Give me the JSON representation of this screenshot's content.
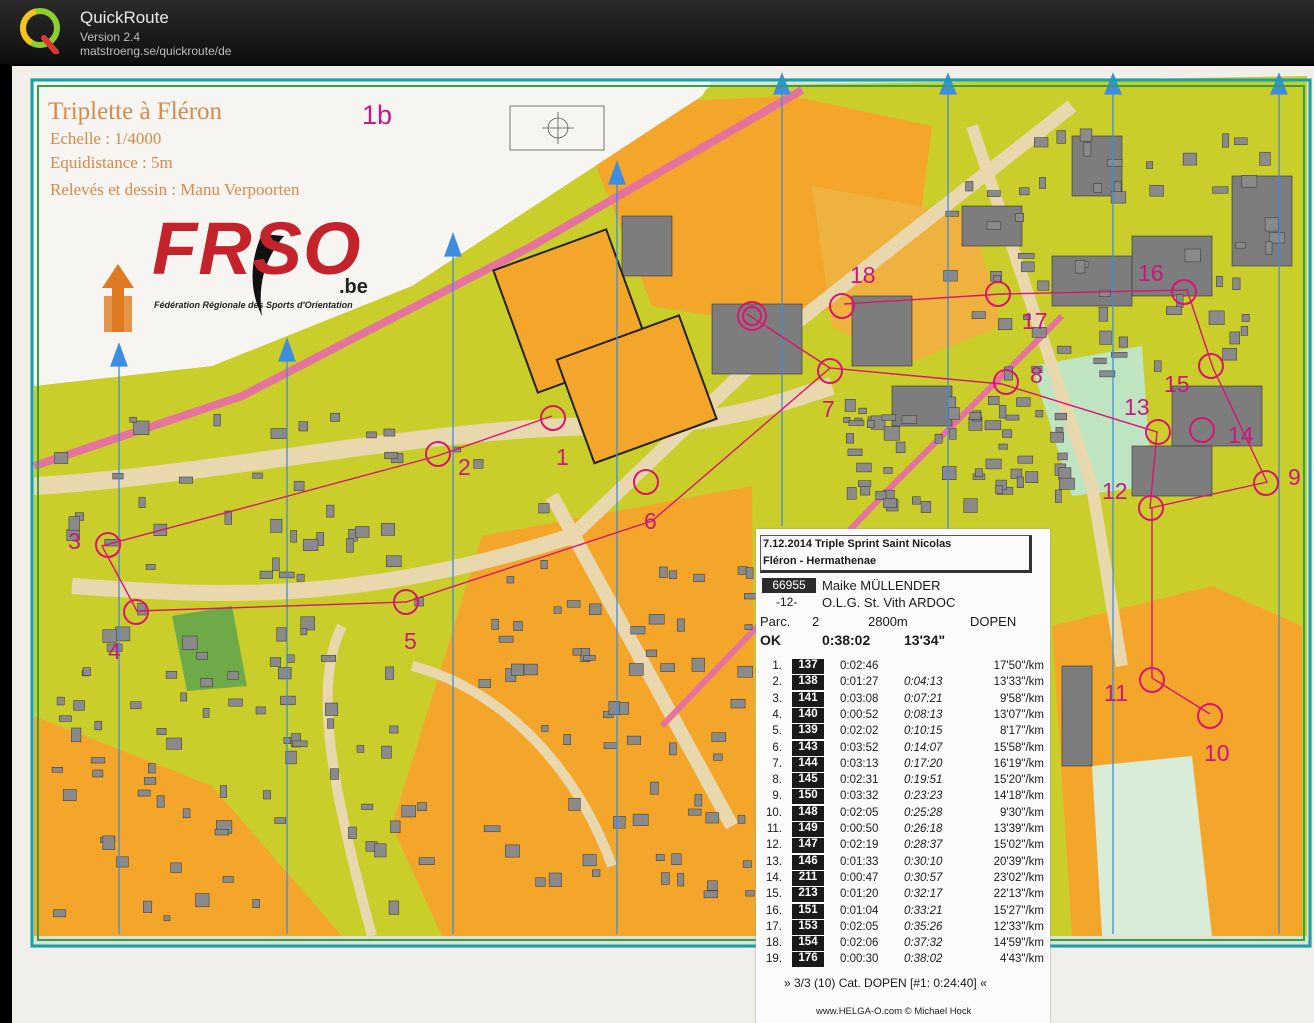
{
  "app": {
    "name": "QuickRoute",
    "version": "Version 2.4",
    "url": "matstroeng.se/quickroute/de",
    "logo_icon": "quickroute-q-logo"
  },
  "map": {
    "title": "Triplette à Fléron",
    "scale": "Echelle : 1/4000",
    "equidistance": "Equidistance : 5m",
    "credit": "Relevés et dessin : Manu Verpoorten",
    "course": "1b",
    "club_logo": {
      "text": "FRSO",
      "suffix": ".be",
      "subtitle": "Fédération Régionale des Sports d'Orientation"
    },
    "controls": [
      "1",
      "2",
      "3",
      "4",
      "5",
      "6",
      "7",
      "8",
      "9",
      "10",
      "11",
      "12",
      "13",
      "14",
      "15",
      "16",
      "17",
      "18"
    ],
    "colors": {
      "route": "#d8166f",
      "open": "#f3a62a",
      "forest": "#c9ce2a",
      "building": "#7d7d7d",
      "paved": "#e9d8ad",
      "north_lines": "#3d8ee0"
    }
  },
  "splits": {
    "event_line1": "7.12.2014   Triple Sprint Saint Nicolas",
    "event_line2": "Fléron - Hermathenae",
    "runner_id": "66955",
    "runner_name": "Maike MÜLLENDER",
    "runner_num": "-12-",
    "club": "O.L.G. St. Vith ARDOC",
    "parc_label": "Parc.",
    "parc_num": "2",
    "length": "2800m",
    "category": "DOPEN",
    "status": "OK",
    "time": "0:38:02",
    "pace": "13'34\"",
    "rows": [
      {
        "idx": "1.",
        "code": "137",
        "leg": "0:02:46",
        "cum": "",
        "pace": "17'50\"/km"
      },
      {
        "idx": "2.",
        "code": "138",
        "leg": "0:01:27",
        "cum": "0:04:13",
        "pace": "13'33\"/km"
      },
      {
        "idx": "3.",
        "code": "141",
        "leg": "0:03:08",
        "cum": "0:07:21",
        "pace": "9'58\"/km"
      },
      {
        "idx": "4.",
        "code": "140",
        "leg": "0:00:52",
        "cum": "0:08:13",
        "pace": "13'07\"/km"
      },
      {
        "idx": "5.",
        "code": "139",
        "leg": "0:02:02",
        "cum": "0:10:15",
        "pace": "8'17\"/km"
      },
      {
        "idx": "6.",
        "code": "143",
        "leg": "0:03:52",
        "cum": "0:14:07",
        "pace": "15'58\"/km"
      },
      {
        "idx": "7.",
        "code": "144",
        "leg": "0:03:13",
        "cum": "0:17:20",
        "pace": "16'19\"/km"
      },
      {
        "idx": "8.",
        "code": "145",
        "leg": "0:02:31",
        "cum": "0:19:51",
        "pace": "15'20\"/km"
      },
      {
        "idx": "9.",
        "code": "150",
        "leg": "0:03:32",
        "cum": "0:23:23",
        "pace": "14'18\"/km"
      },
      {
        "idx": "10.",
        "code": "148",
        "leg": "0:02:05",
        "cum": "0:25:28",
        "pace": "9'30\"/km"
      },
      {
        "idx": "11.",
        "code": "149",
        "leg": "0:00:50",
        "cum": "0:26:18",
        "pace": "13'39\"/km"
      },
      {
        "idx": "12.",
        "code": "147",
        "leg": "0:02:19",
        "cum": "0:28:37",
        "pace": "15'02\"/km"
      },
      {
        "idx": "13.",
        "code": "146",
        "leg": "0:01:33",
        "cum": "0:30:10",
        "pace": "20'39\"/km"
      },
      {
        "idx": "14.",
        "code": "211",
        "leg": "0:00:47",
        "cum": "0:30:57",
        "pace": "23'02\"/km"
      },
      {
        "idx": "15.",
        "code": "213",
        "leg": "0:01:20",
        "cum": "0:32:17",
        "pace": "22'13\"/km"
      },
      {
        "idx": "16.",
        "code": "151",
        "leg": "0:01:04",
        "cum": "0:33:21",
        "pace": "15'27\"/km"
      },
      {
        "idx": "17.",
        "code": "153",
        "leg": "0:02:05",
        "cum": "0:35:26",
        "pace": "12'33\"/km"
      },
      {
        "idx": "18.",
        "code": "154",
        "leg": "0:02:06",
        "cum": "0:37:32",
        "pace": "14'59\"/km"
      },
      {
        "idx": "19.",
        "code": "176",
        "leg": "0:00:30",
        "cum": "0:38:02",
        "pace": "4'43\"/km"
      }
    ],
    "footer": "» 3/3 (10) Cat. DOPEN [#1: 0:24:40] «",
    "credit": "www.HELGA-O.com © Michael Hock"
  }
}
